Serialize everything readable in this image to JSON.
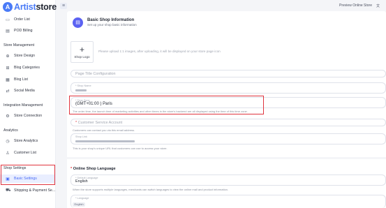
{
  "brand": {
    "name_a": "Artist",
    "name_b": "store",
    "mark": "A"
  },
  "header": {
    "preview_label": "Preview Online Store",
    "translate_glyph": "文"
  },
  "sidebar": {
    "items_top": [
      {
        "label": "Order List",
        "icon": "list-icon"
      },
      {
        "label": "POD Billing",
        "icon": "billing-icon"
      }
    ],
    "sections": [
      {
        "title": "Store Management",
        "items": [
          {
            "label": "Store Design",
            "icon": "design-icon"
          },
          {
            "label": "Blog Categories",
            "icon": "grid-icon"
          },
          {
            "label": "Blog List",
            "icon": "blog-icon"
          },
          {
            "label": "Social Media",
            "icon": "share-icon"
          }
        ]
      },
      {
        "title": "Integration Management",
        "items": [
          {
            "label": "Store Connection",
            "icon": "gear-icon"
          }
        ]
      },
      {
        "title": "Analytics",
        "items": [
          {
            "label": "Store Analytics",
            "icon": "analytics-icon"
          },
          {
            "label": "Customer List",
            "icon": "customer-icon"
          }
        ]
      },
      {
        "title": "Shop Settings",
        "items": [
          {
            "label": "Basic Settings",
            "icon": "settings-icon",
            "active": true
          },
          {
            "label": "Shipping & Payment Se...",
            "icon": "truck-icon"
          }
        ]
      }
    ]
  },
  "page": {
    "title": "Basic Shop Information",
    "subtitle": "Set up your shop basic information",
    "logo_plus": "+",
    "logo_label": "Shop Logo",
    "upload_hint": "Please upload 1:1 images, after uploading, it will be displayed on your store page icon",
    "page_title_placeholder": "Page Title Configuration",
    "shop_name_label": "* Shop Name",
    "time_zone_label": "* Time Zone",
    "time_zone_value": "(GMT+01:00 ) Paris",
    "time_zone_help": "The order time, the launch time of marketing activities and other times in the store's backend are all displayed using the time of this time zone.",
    "customer_service_placeholder": "Customer Service Account",
    "customer_service_help": "Customers can contact you via this email address.",
    "shop_link_label": "Shop Link",
    "shop_link_help": "This is your shop's unique URL that customers can use to access your store."
  },
  "language_section": {
    "title": "Online Shop Language",
    "default_label": "* Default Language",
    "default_value": "English",
    "default_help": "When the store supports multiple languages, merchants can switch languages to view the online mall and product information.",
    "language_label": "* Language",
    "language_chip": "English"
  },
  "colors": {
    "accent": "#4a6cf7",
    "highlight": "#e0343e"
  }
}
